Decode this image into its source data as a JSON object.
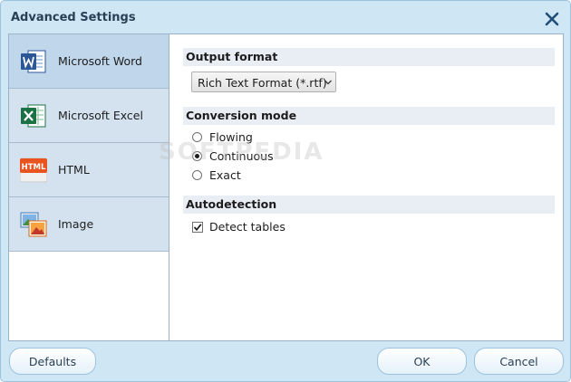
{
  "window": {
    "title": "Advanced Settings",
    "close_icon": "close-icon"
  },
  "sidebar": {
    "items": [
      {
        "label": "Microsoft Word",
        "icon": "word-icon",
        "active": true
      },
      {
        "label": "Microsoft Excel",
        "icon": "excel-icon",
        "active": false
      },
      {
        "label": "HTML",
        "icon": "html-icon",
        "active": false
      },
      {
        "label": "Image",
        "icon": "image-icon",
        "active": false
      }
    ]
  },
  "icons": {
    "html_badge_text": "HTML"
  },
  "output_format": {
    "header": "Output format",
    "selected": "Rich Text Format (*.rtf)"
  },
  "conversion_mode": {
    "header": "Conversion mode",
    "options": [
      {
        "label": "Flowing",
        "checked": false
      },
      {
        "label": "Continuous",
        "checked": true
      },
      {
        "label": "Exact",
        "checked": false
      }
    ]
  },
  "autodetection": {
    "header": "Autodetection",
    "detect_tables_label": "Detect tables",
    "detect_tables_checked": true
  },
  "watermark": "SOFTPEDIA",
  "buttons": {
    "defaults": "Defaults",
    "ok": "OK",
    "cancel": "Cancel"
  },
  "colors": {
    "frame_bg": "#cfe6f5",
    "sidebar_active": "#c0d6ea",
    "sidebar_item": "#d4e2ef",
    "title_text": "#2a3f54",
    "close_x": "#1f4f7a"
  }
}
